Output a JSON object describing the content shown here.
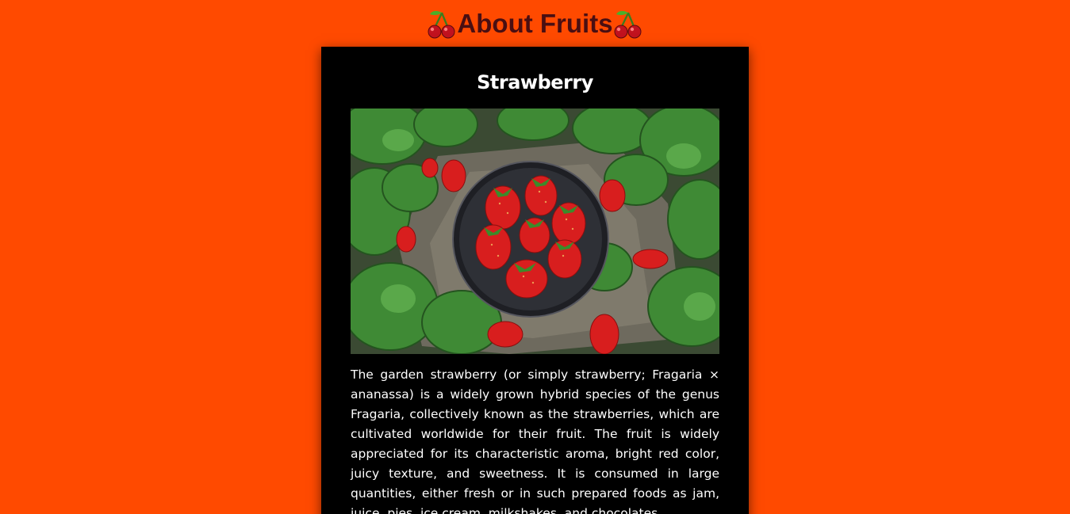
{
  "header": {
    "title": "About Fruits",
    "left_icon": "cherry-icon",
    "right_icon": "cherry-icon"
  },
  "card": {
    "title": "Strawberry",
    "image_subject": "strawberries on a dark plate among strawberry leaves",
    "description": "The garden strawberry (or simply strawberry; Fragaria × ananassa) is a widely grown hybrid species of the genus Fragaria, collectively known as the strawberries, which are cultivated worldwide for their fruit. The fruit is widely appreciated for its characteristic aroma, bright red color, juicy texture, and sweetness. It is consumed in large quantities, either fresh or in such prepared foods as jam, juice, pies, ice cream, milkshakes, and chocolates."
  },
  "colors": {
    "page_background": "#ff4a00",
    "header_text": "#4a0f12",
    "card_background": "#000000",
    "card_text": "#ffffff"
  }
}
